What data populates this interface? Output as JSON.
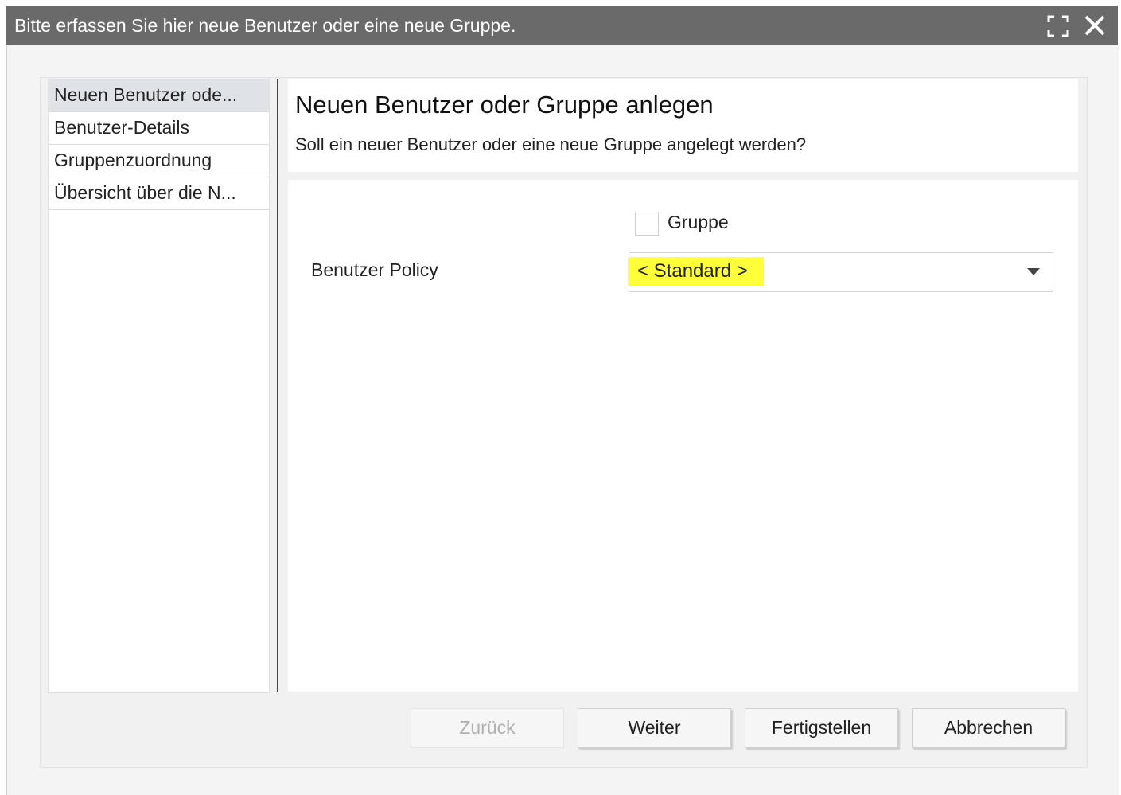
{
  "window": {
    "title": "Bitte erfassen Sie hier neue Benutzer oder eine neue Gruppe.",
    "titlebar_color": "#6a6a6a",
    "maximize_icon": "maximize-icon",
    "close_icon": "close-icon"
  },
  "nav": {
    "items": [
      {
        "label": "Neuen Benutzer ode...",
        "active": true
      },
      {
        "label": "Benutzer-Details",
        "active": false
      },
      {
        "label": "Gruppenzuordnung",
        "active": false
      },
      {
        "label": "Übersicht über die N...",
        "active": false
      }
    ]
  },
  "header": {
    "title": "Neuen Benutzer oder Gruppe anlegen",
    "subtitle": "Soll ein neuer Benutzer oder eine neue Gruppe angelegt werden?"
  },
  "form": {
    "group_checkbox": {
      "label": "Gruppe",
      "checked": false
    },
    "policy": {
      "label": "Benutzer Policy",
      "selected": "< Standard >",
      "highlight_color": "#ffff3a"
    }
  },
  "footer": {
    "back_label": "Zurück",
    "back_disabled": true,
    "next_label": "Weiter",
    "finish_label": "Fertigstellen",
    "cancel_label": "Abbrechen"
  }
}
